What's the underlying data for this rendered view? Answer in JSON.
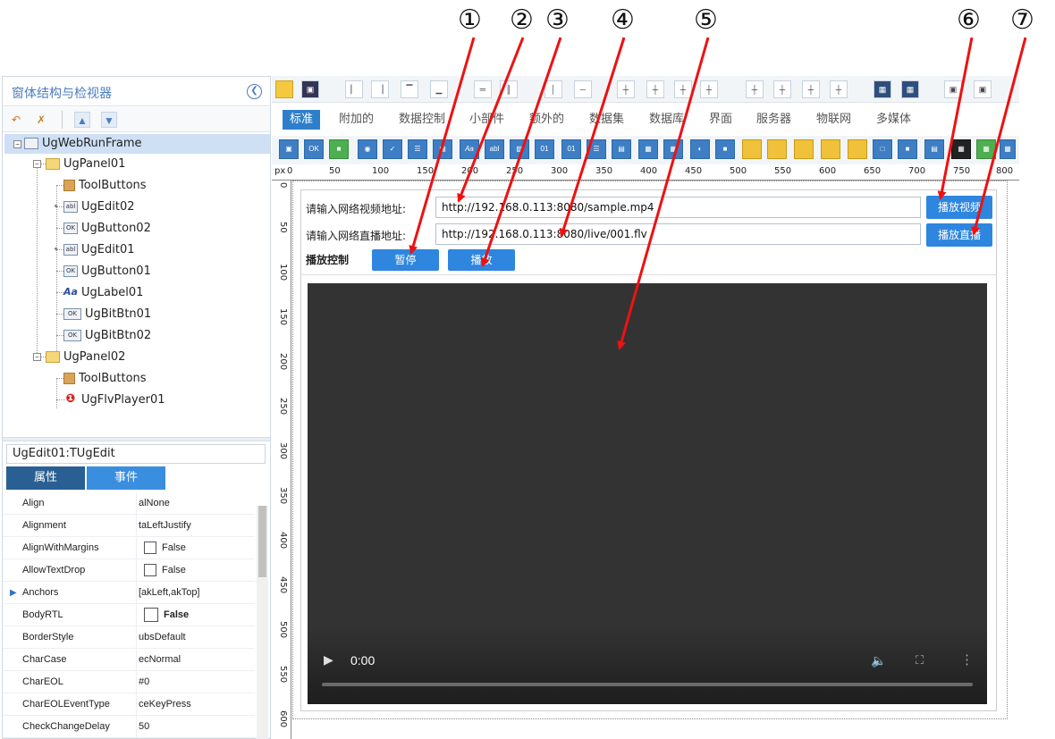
{
  "left_panel": {
    "title": "窗体结构与检视器",
    "collapse_icon": "chevron-left-icon",
    "tree": [
      {
        "label": "UgWebRunFrame",
        "icon": "frame-icon"
      },
      {
        "label": "UgPanel01",
        "icon": "panel-icon"
      },
      {
        "label": "ToolButtons",
        "icon": "folder-icon"
      },
      {
        "label": "UgEdit02",
        "icon": "edit-icon"
      },
      {
        "label": "UgButton02",
        "icon": "button-icon"
      },
      {
        "label": "UgEdit01",
        "icon": "edit-icon"
      },
      {
        "label": "UgButton01",
        "icon": "button-icon"
      },
      {
        "label": "UgLabel01",
        "icon": "label-icon"
      },
      {
        "label": "UgBitBtn01",
        "icon": "bitbtn-icon"
      },
      {
        "label": "UgBitBtn02",
        "icon": "bitbtn-icon"
      },
      {
        "label": "UgPanel02",
        "icon": "panel-icon"
      },
      {
        "label": "ToolButtons",
        "icon": "folder-icon"
      },
      {
        "label": "UgFlvPlayer01",
        "icon": "flv-icon"
      }
    ],
    "object_name": "UgEdit01:TUgEdit",
    "tabs": [
      "属性",
      "事件"
    ],
    "properties": [
      {
        "name": "Align",
        "value": "alNone"
      },
      {
        "name": "Alignment",
        "value": "taLeftJustify"
      },
      {
        "name": "AlignWithMargins",
        "value": "False"
      },
      {
        "name": "AllowTextDrop",
        "value": "False"
      },
      {
        "name": "Anchors",
        "value": "[akLeft,akTop]"
      },
      {
        "name": "BodyRTL",
        "value": "False"
      },
      {
        "name": "BorderStyle",
        "value": "ubsDefault"
      },
      {
        "name": "CharCase",
        "value": "ecNormal"
      },
      {
        "name": "CharEOL",
        "value": "#0"
      },
      {
        "name": "CharEOLEventType",
        "value": "ceKeyPress"
      },
      {
        "name": "CheckChangeDelay",
        "value": "50"
      }
    ]
  },
  "categories": [
    "标准",
    "附加的",
    "数据控制",
    "小部件",
    "额外的",
    "数据集",
    "数据库",
    "界面",
    "服务器",
    "物联网",
    "多媒体"
  ],
  "ruler": {
    "unit": "px",
    "h_labels": [
      "0",
      "50",
      "100",
      "150",
      "200",
      "250",
      "300",
      "350",
      "400",
      "450",
      "500",
      "550",
      "600",
      "650",
      "700",
      "750",
      "800"
    ],
    "v_labels": [
      "0",
      "50",
      "100",
      "150",
      "200",
      "250",
      "300",
      "350",
      "400",
      "450",
      "500",
      "550",
      "600"
    ]
  },
  "form": {
    "video_label": "请输入网络视频地址:",
    "video_url": "http://192.168.0.113:8080/sample.mp4",
    "live_label": "请输入网络直播地址:",
    "live_url": "http://192.168.0.113:8080/live/001.flv",
    "play_video_btn": "播放视频",
    "play_live_btn": "播放直播",
    "control_label": "播放控制",
    "pause_btn": "暂停",
    "play_btn": "播放"
  },
  "player": {
    "time": "0:00",
    "icons": [
      "play-icon",
      "volume-icon",
      "fullscreen-icon",
      "more-icon"
    ]
  },
  "annotations": [
    "①",
    "②",
    "③",
    "④",
    "⑤",
    "⑥",
    "⑦"
  ],
  "colors": {
    "accent": "#2e86de",
    "arrow": "#ee1111",
    "selected": "#cfe0f5",
    "video_bg": "#333333"
  }
}
